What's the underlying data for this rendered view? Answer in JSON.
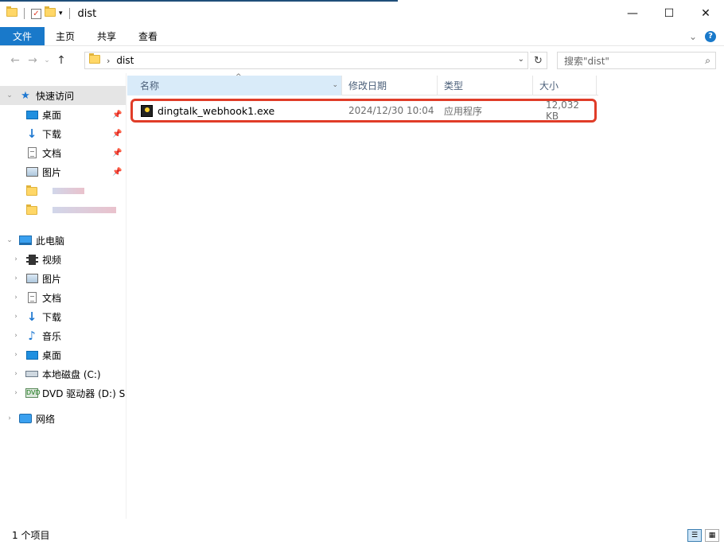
{
  "window": {
    "title": "dist",
    "controls": {
      "minimize": "—",
      "maximize": "☐",
      "close": "✕"
    }
  },
  "ribbon": {
    "tabs": [
      "文件",
      "主页",
      "共享",
      "查看"
    ],
    "expand_glyph": "⌄",
    "help_glyph": "?"
  },
  "address": {
    "path": [
      "dist"
    ],
    "search_placeholder": "搜索\"dist\"",
    "refresh_glyph": "↻"
  },
  "nav": {
    "quick_access": "快速访问",
    "quick_items": [
      "桌面",
      "下载",
      "文档",
      "图片"
    ],
    "this_pc": "此电脑",
    "pc_items": [
      "视频",
      "图片",
      "文档",
      "下载",
      "音乐",
      "桌面",
      "本地磁盘 (C:)",
      "DVD 驱动器 (D:) SS"
    ],
    "network": "网络"
  },
  "columns": {
    "name": "名称",
    "date": "修改日期",
    "type": "类型",
    "size": "大小"
  },
  "files": [
    {
      "name": "dingtalk_webhook1.exe",
      "date": "2024/12/30 10:04",
      "type": "应用程序",
      "size": "12,032 KB"
    }
  ],
  "status": {
    "count": "1 个项目"
  },
  "colors": {
    "accent": "#1979ca",
    "highlight_border": "#e03c28",
    "header_selected": "#d9ebf9"
  }
}
